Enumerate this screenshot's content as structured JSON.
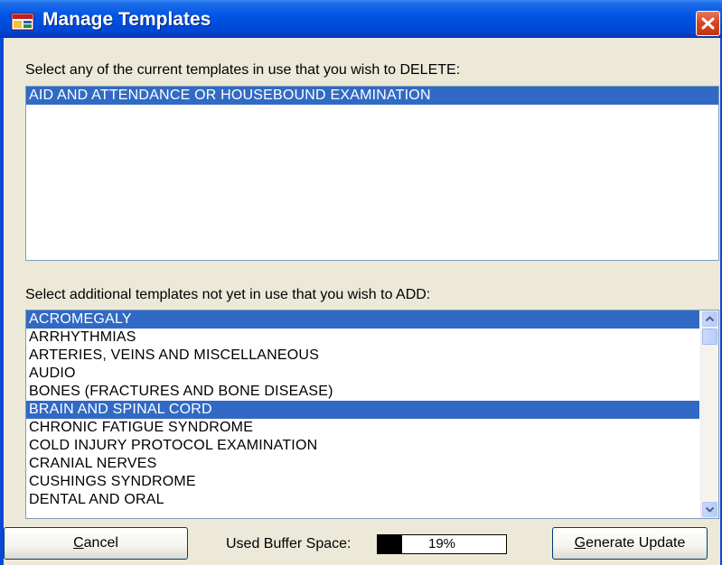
{
  "window": {
    "title": "Manage Templates"
  },
  "delete_section": {
    "label": "Select any of the current templates in use that you wish to DELETE:",
    "items": [
      {
        "text": "AID AND ATTENDANCE OR HOUSEBOUND EXAMINATION",
        "selected": true
      }
    ]
  },
  "add_section": {
    "label": "Select additional templates not yet in use that you wish to ADD:",
    "items": [
      {
        "text": "ACROMEGALY",
        "selected": true
      },
      {
        "text": "ARRHYTHMIAS",
        "selected": false
      },
      {
        "text": "ARTERIES, VEINS AND MISCELLANEOUS",
        "selected": false
      },
      {
        "text": "AUDIO",
        "selected": false
      },
      {
        "text": "BONES (FRACTURES AND BONE DISEASE)",
        "selected": false
      },
      {
        "text": "BRAIN AND SPINAL CORD",
        "selected": true
      },
      {
        "text": "CHRONIC FATIGUE SYNDROME",
        "selected": false
      },
      {
        "text": "COLD INJURY PROTOCOL EXAMINATION",
        "selected": false
      },
      {
        "text": "CRANIAL NERVES",
        "selected": false
      },
      {
        "text": "CUSHINGS SYNDROME",
        "selected": false
      },
      {
        "text": "DENTAL AND ORAL",
        "selected": false
      }
    ]
  },
  "footer": {
    "cancel_label": "Cancel",
    "buffer_label": "Used Buffer Space:",
    "buffer_percent": 19,
    "buffer_text": "19%",
    "generate_label": "Generate Update"
  },
  "colors": {
    "titlebar": "#0055E5",
    "selection": "#316AC5",
    "dialog_bg": "#ECE9D8"
  }
}
